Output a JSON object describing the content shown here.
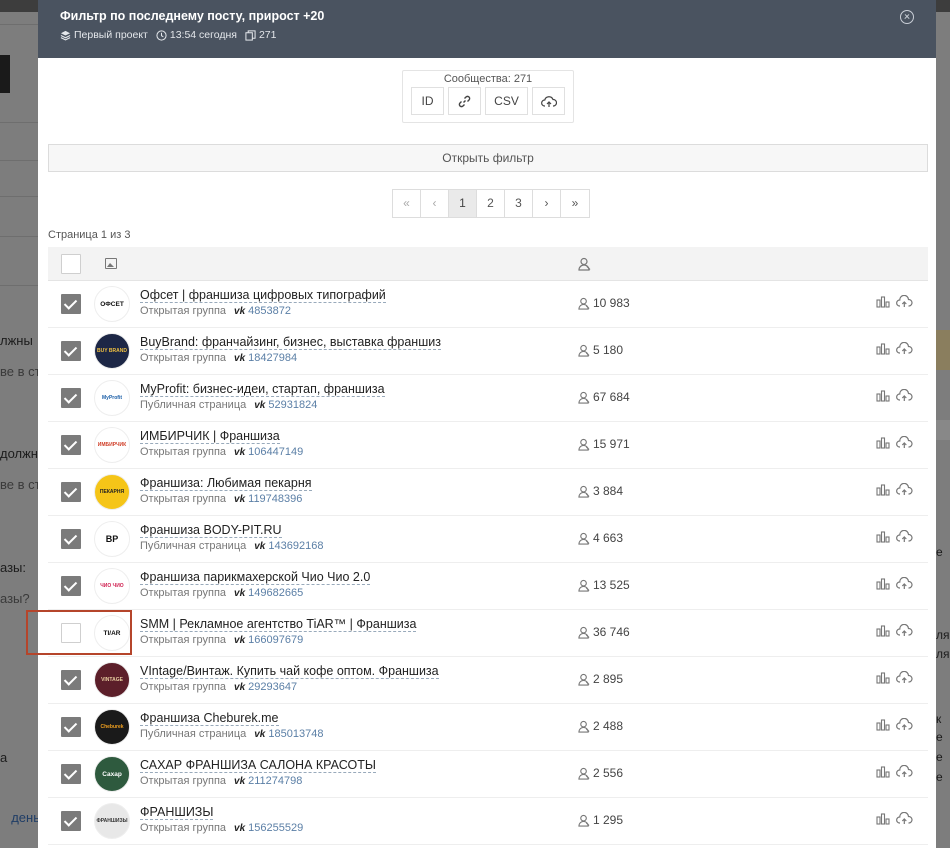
{
  "background": {
    "left_texts": [
      "лжны",
      "ве в ст",
      "должн",
      "ве в ст",
      "азы:",
      "азы?",
      "а",
      "день"
    ],
    "right_texts": [
      "е",
      "ля",
      "ля",
      "к",
      "е",
      "е",
      "е"
    ]
  },
  "modal": {
    "title": "Фильтр по последнему посту, прирост +20",
    "project": "Первый проект",
    "time": "13:54 сегодня",
    "count": "271",
    "close_icon": "close-circle-icon"
  },
  "export": {
    "label": "Сообщества: 271",
    "buttons": [
      "ID",
      "link-icon",
      "CSV",
      "cloud-upload-icon"
    ],
    "id_label": "ID",
    "csv_label": "CSV"
  },
  "open_filter_label": "Открыть фильтр",
  "pagination": {
    "first": "«",
    "prev": "‹",
    "pages": [
      "1",
      "2",
      "3"
    ],
    "current": "1",
    "next": "›",
    "last": "»"
  },
  "page_info": "Страница 1 из 3",
  "groups": [
    {
      "name": "Офсет | франшиза цифровых типографий",
      "type": "Открытая группа",
      "vk_id": "4853872",
      "members": "10 983",
      "checked": true,
      "avatar_text": "ОФСЕТ",
      "avatar_bg": "#ffffff",
      "avatar_fg": "#111111"
    },
    {
      "name": "BuyBrand: франчайзинг, бизнес, выставка франшиз",
      "type": "Открытая группа",
      "vk_id": "18427984",
      "members": "5 180",
      "checked": true,
      "avatar_text": "BUY BRAND",
      "avatar_bg": "#1d2746",
      "avatar_fg": "#f0c040"
    },
    {
      "name": "MyProfit: бизнес-идеи, стартап, франшиза",
      "type": "Публичная страница",
      "vk_id": "52931824",
      "members": "67 684",
      "checked": true,
      "avatar_text": "MyProfit",
      "avatar_bg": "#ffffff",
      "avatar_fg": "#1b5fa8"
    },
    {
      "name": "ИМБИРЧИК | Франшиза",
      "type": "Открытая группа",
      "vk_id": "106447149",
      "members": "15 971",
      "checked": true,
      "avatar_text": "ИМБИРЧИК",
      "avatar_bg": "#ffffff",
      "avatar_fg": "#d0402a"
    },
    {
      "name": "Франшиза: Любимая пекарня",
      "type": "Открытая группа",
      "vk_id": "119748396",
      "members": "3 884",
      "checked": true,
      "avatar_text": "ПЕКАРНЯ",
      "avatar_bg": "#f5c518",
      "avatar_fg": "#222222"
    },
    {
      "name": "Франшиза BODY-PIT.RU",
      "type": "Публичная страница",
      "vk_id": "143692168",
      "members": "4 663",
      "checked": true,
      "avatar_text": "BP",
      "avatar_bg": "#ffffff",
      "avatar_fg": "#111111"
    },
    {
      "name": "Франшиза парикмахерской Чио Чио 2.0",
      "type": "Открытая группа",
      "vk_id": "149682665",
      "members": "13 525",
      "checked": true,
      "avatar_text": "ЧИО ЧИО",
      "avatar_bg": "#ffffff",
      "avatar_fg": "#d02050"
    },
    {
      "name": "SMM | Рекламное агентство TiAR™ | Франшиза",
      "type": "Открытая группа",
      "vk_id": "166097679",
      "members": "36 746",
      "checked": false,
      "avatar_text": "TI/AR",
      "avatar_bg": "#ffffff",
      "avatar_fg": "#111111"
    },
    {
      "name": "VIntage/Винтаж. Купить чай кофе оптом. Франшиза",
      "type": "Открытая группа",
      "vk_id": "29293647",
      "members": "2 895",
      "checked": true,
      "avatar_text": "VINTAGE",
      "avatar_bg": "#5c1f2a",
      "avatar_fg": "#e8cfa0"
    },
    {
      "name": "Франшиза Cheburek.me",
      "type": "Публичная страница",
      "vk_id": "185013748",
      "members": "2 488",
      "checked": true,
      "avatar_text": "Cheburek",
      "avatar_bg": "#1a1a1a",
      "avatar_fg": "#f0a020"
    },
    {
      "name": "САХАР ФРАНШИЗА САЛОНА КРАСОТЫ",
      "type": "Открытая группа",
      "vk_id": "211274798",
      "members": "2 556",
      "checked": true,
      "avatar_text": "Сахар",
      "avatar_bg": "#2e5a3e",
      "avatar_fg": "#ffffff"
    },
    {
      "name": "ФРАНШИЗЫ",
      "type": "Открытая группа",
      "vk_id": "156255529",
      "members": "1 295",
      "checked": true,
      "avatar_text": "ФРАНШИЗЫ",
      "avatar_bg": "#e8e8e8",
      "avatar_fg": "#333333"
    }
  ]
}
